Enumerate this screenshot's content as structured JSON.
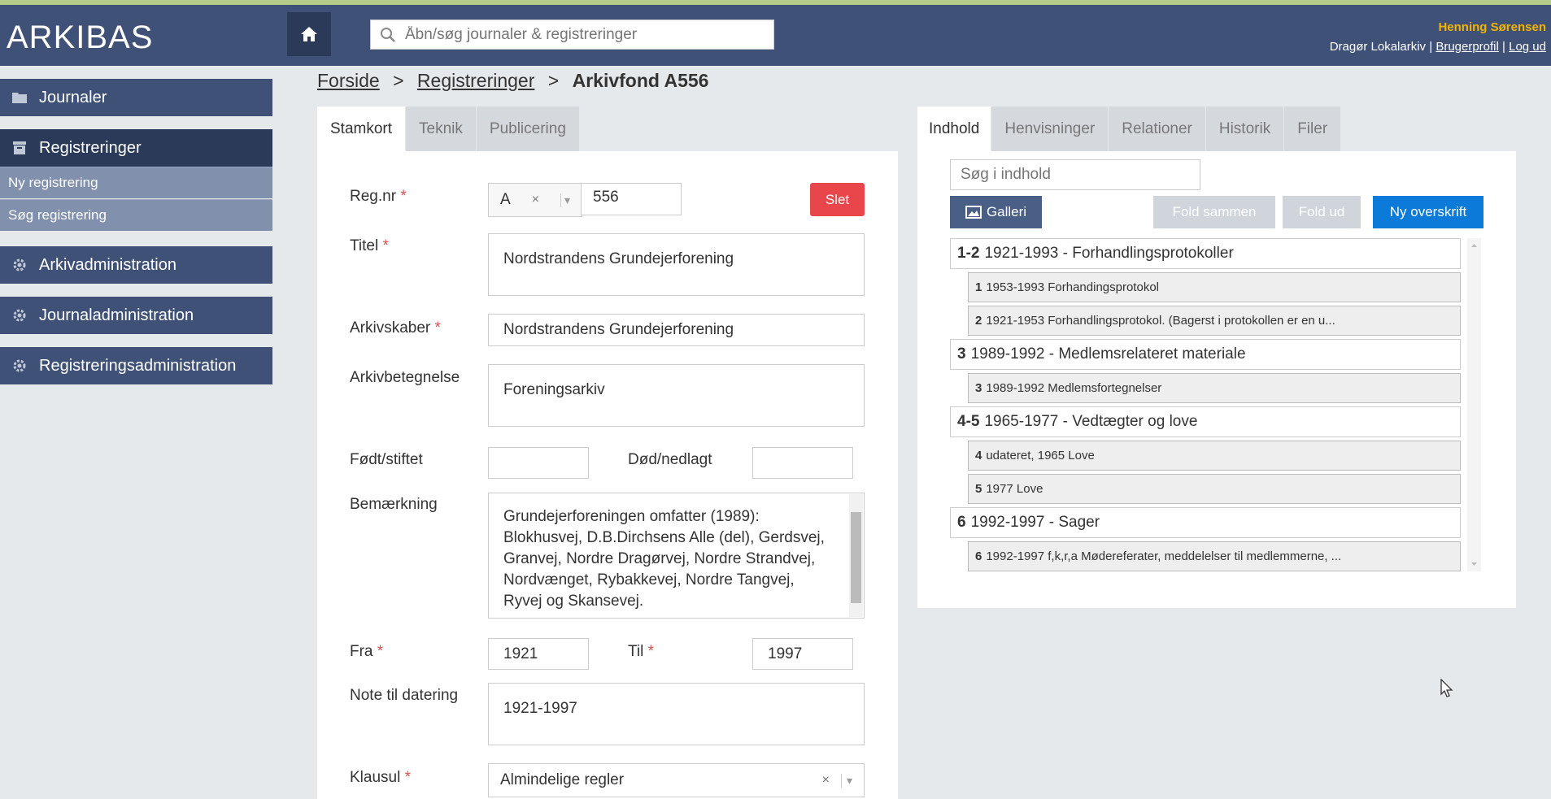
{
  "header": {
    "logo": "ARKIBAS",
    "search_placeholder": "Åbn/søg journaler & registreringer",
    "user_name": "Henning Sørensen",
    "archive": "Dragør Lokalarkiv",
    "profile_link": "Brugerprofil",
    "logout_link": "Log ud",
    "sep": "|"
  },
  "sidebar": {
    "journaler": "Journaler",
    "registreringer": "Registreringer",
    "ny_registrering": "Ny registrering",
    "sog_registrering": "Søg registrering",
    "arkivadministration": "Arkivadministration",
    "journaladministration": "Journaladministration",
    "registreringsadministration": "Registreringsadministration"
  },
  "breadcrumb": {
    "home": "Forside",
    "sep": ">",
    "registreringer": "Registreringer",
    "current": "Arkivfond A556"
  },
  "left_tabs": [
    "Stamkort",
    "Teknik",
    "Publicering"
  ],
  "form": {
    "regnr_label": "Reg.nr",
    "regnr_prefix": "A",
    "regnr_clear": "×",
    "regnr_arrow": "▾",
    "regnr_value": "556",
    "delete_button": "Slet",
    "titel_label": "Titel",
    "titel_value": "Nordstrandens Grundejerforening",
    "arkivskaber_label": "Arkivskaber",
    "arkivskaber_value": "Nordstrandens Grundejerforening",
    "arkivbetegnelse_label": "Arkivbetegnelse",
    "arkivbetegnelse_value": "Foreningsarkiv",
    "fodt_label": "Født/stiftet",
    "fodt_value": "",
    "dod_label": "Død/nedlagt",
    "dod_value": "",
    "bemaerkning_label": "Bemærkning",
    "bemaerkning_value": "Grundejerforeningen omfatter (1989): Blokhusvej, D.B.Dirchsens Alle (del), Gerdsvej, Granvej, Nordre Dragørvej, Nordre Strandvej, Nordvænget, Rybakkevej, Nordre Tangvej, Ryvej og Skansevej.",
    "fra_label": "Fra",
    "fra_value": "1921",
    "til_label": "Til",
    "til_value": "1997",
    "note_label": "Note til datering",
    "note_value": "1921-1997",
    "klausul_label": "Klausul",
    "klausul_value": "Almindelige regler",
    "klausul_clear": "×",
    "klausul_arrow": "▾",
    "required_mark": "*"
  },
  "right_tabs": [
    "Indhold",
    "Henvisninger",
    "Relationer",
    "Historik",
    "Filer"
  ],
  "content": {
    "search_placeholder": "Søg i indhold",
    "gallery_button": "Galleri",
    "collapse_button": "Fold sammen",
    "expand_button": "Fold ud",
    "new_heading_button": "Ny overskrift",
    "tree": [
      {
        "num": "1-2",
        "text": "1921-1993 - Forhandlingsprotokoller",
        "children": [
          {
            "num": "1",
            "text": "1953-1993 Forhandingsprotokol"
          },
          {
            "num": "2",
            "text": "1921-1953 Forhandlingsprotokol. (Bagerst i protokollen er en u..."
          }
        ]
      },
      {
        "num": "3",
        "text": "1989-1992 - Medlemsrelateret materiale",
        "children": [
          {
            "num": "3",
            "text": "1989-1992 Medlemsfortegnelser"
          }
        ]
      },
      {
        "num": "4-5",
        "text": "1965-1977 - Vedtægter og love",
        "children": [
          {
            "num": "4",
            "text": "udateret, 1965 Love"
          },
          {
            "num": "5",
            "text": "1977 Love"
          }
        ]
      },
      {
        "num": "6",
        "text": "1992-1997 - Sager",
        "children": [
          {
            "num": "6",
            "text": "1992-1997 f,k,r,a Mødereferater, meddelelser til medlemmerne, ..."
          }
        ]
      }
    ]
  }
}
